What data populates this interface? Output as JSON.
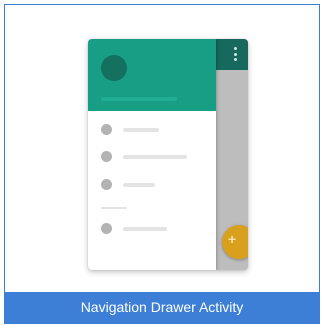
{
  "template": {
    "caption": "Navigation Drawer Activity",
    "selected": true,
    "icons": {
      "overflow": "overflow-menu-icon",
      "fab": "plus-icon"
    },
    "colors": {
      "selection": "#3d7fd6",
      "drawer_header": "#199e86",
      "app_bar": "#16695c",
      "fab": "#d9a01d"
    }
  }
}
